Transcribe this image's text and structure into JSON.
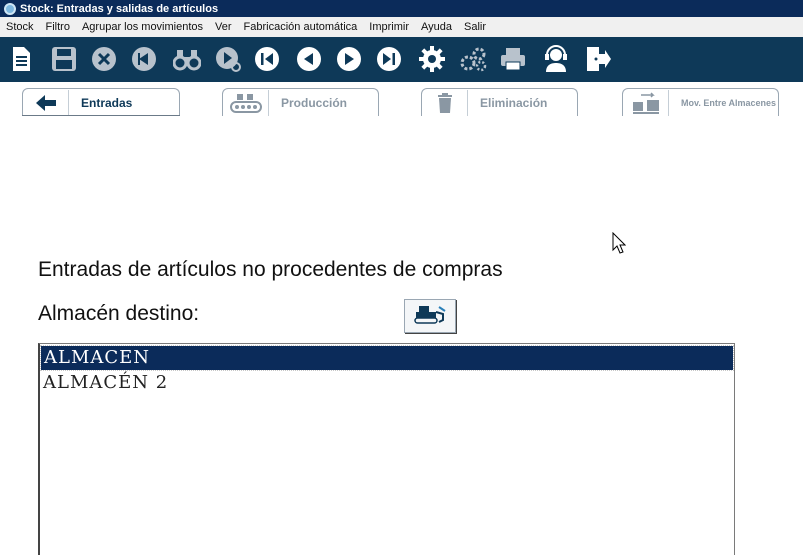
{
  "window": {
    "title": "Stock: Entradas y salidas de artículos"
  },
  "menu": [
    "Stock",
    "Filtro",
    "Agrupar los movimientos",
    "Ver",
    "Fabricación automática",
    "Imprimir",
    "Ayuda",
    "Salir"
  ],
  "toolbar_icons": [
    "document-icon",
    "save-icon",
    "cancel-icon",
    "back-circle-icon",
    "binoculars-icon",
    "search-next-icon",
    "first-record-icon",
    "previous-record-icon",
    "next-record-icon",
    "last-record-icon",
    "settings-icon",
    "multi-gear-icon",
    "print-icon",
    "support-agent-icon",
    "exit-icon"
  ],
  "tabs": [
    {
      "label": "Entradas",
      "icon": "arrow-left-icon",
      "active": true
    },
    {
      "label": "Producción",
      "icon": "conveyor-icon",
      "active": false
    },
    {
      "label": "Eliminación",
      "icon": "trash-icon",
      "active": false
    },
    {
      "label": "Mov. Entre Almacenes",
      "icon": "transfer-icon",
      "active": false
    }
  ],
  "main": {
    "heading": "Entradas de artículos no procedentes de compras",
    "warehouse_label": "Almacén destino:",
    "lookup_icon": "bulldozer-icon",
    "warehouses": [
      "ALMACEN",
      "ALMACÉN 2"
    ],
    "selected_index": 0
  },
  "colors": {
    "title_bar": "#0b2b5a",
    "toolbar": "#0e3958",
    "selection": "#0b2b5a"
  }
}
